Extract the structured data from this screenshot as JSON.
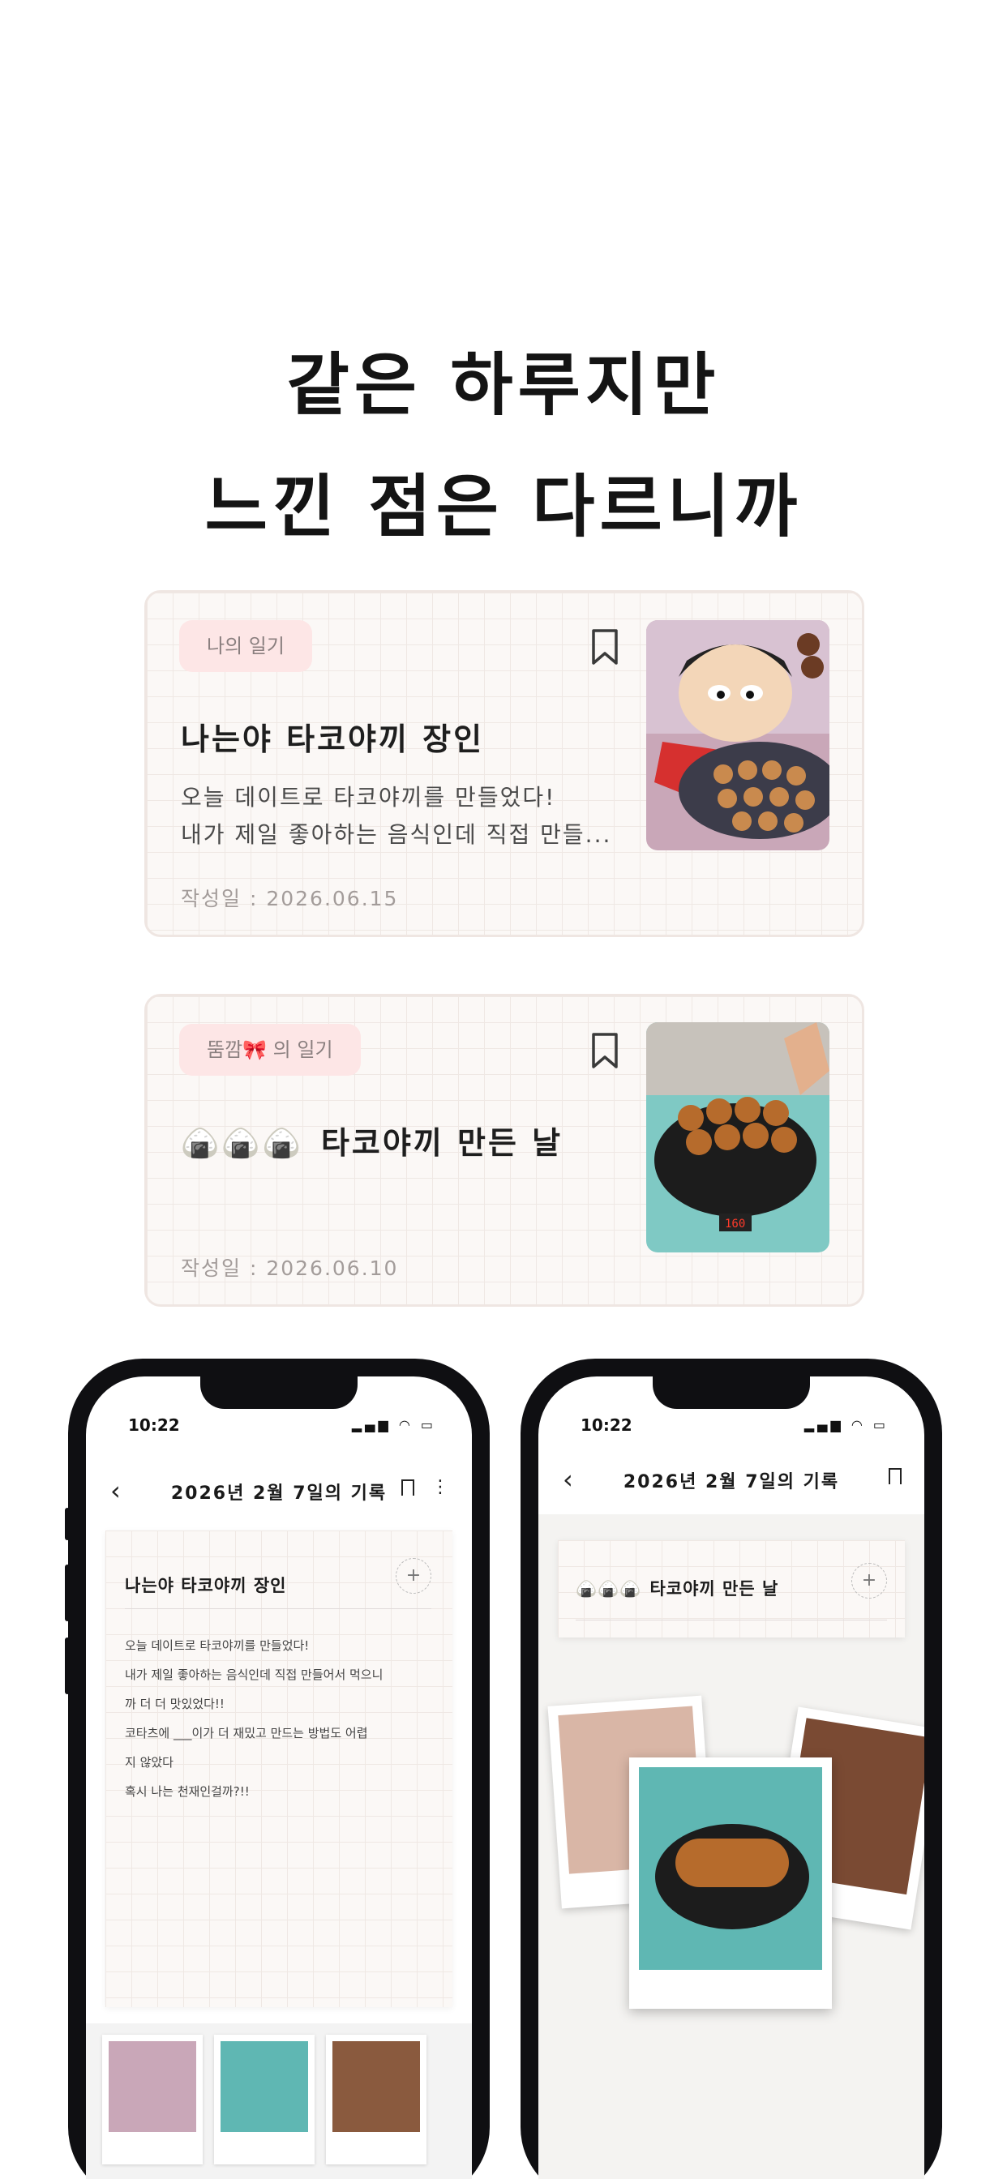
{
  "headline": {
    "line1": "같은 하루지만",
    "line2": "느낀 점은 다르니까"
  },
  "cards": [
    {
      "tag": "나의 일기",
      "title": "나는야 타코야끼 장인",
      "body_line1": "오늘 데이트로 타코야끼를 만들었다!",
      "body_line2": "내가 제일 좋아하는 음식인데 직접 만들...",
      "date": "작성일 : 2026.06.15",
      "bookmark_icon": "bookmark-outline-icon",
      "image": "cartoon-takoyaki-thumbnail"
    },
    {
      "tag": "뚬깜🎀 의 일기",
      "title_emoji": "🍙🍙🍙",
      "title": "타코야끼 만든 날",
      "date": "작성일 : 2026.06.10",
      "bookmark_icon": "bookmark-outline-icon",
      "image": "takoyaki-pan-photo"
    }
  ],
  "phone_left": {
    "time": "10:22",
    "title": "2026년 2월 7일의 기록",
    "entry_title": "나는야 타코야끼 장인",
    "entry_lines": [
      "오늘 데이트로 타코야끼를 만들었다!",
      "내가 제일 좋아하는 음식인데 직접 만들어서 먹으니",
      "까 더 더 맛있었다!!",
      "코타츠에 ___이가 더 재밌고 만드는 방법도 어렵",
      "지 않았다",
      "혹시 나는 천재인걸까?!!"
    ],
    "add_label": "+"
  },
  "phone_right": {
    "time": "10:22",
    "title": "2026년 2월 7일의 기록",
    "entry_emoji": "🍙🍙🍙",
    "entry_title": "타코야끼 만든 날",
    "add_label": "+"
  },
  "icons": {
    "back": "‹",
    "more": "⋮",
    "status": "▂▄▆ ◠ ▭"
  },
  "colors": {
    "tag_bg": "#fde6e6",
    "card_border": "#efe6e2",
    "phone_frame": "#0f0f12"
  }
}
